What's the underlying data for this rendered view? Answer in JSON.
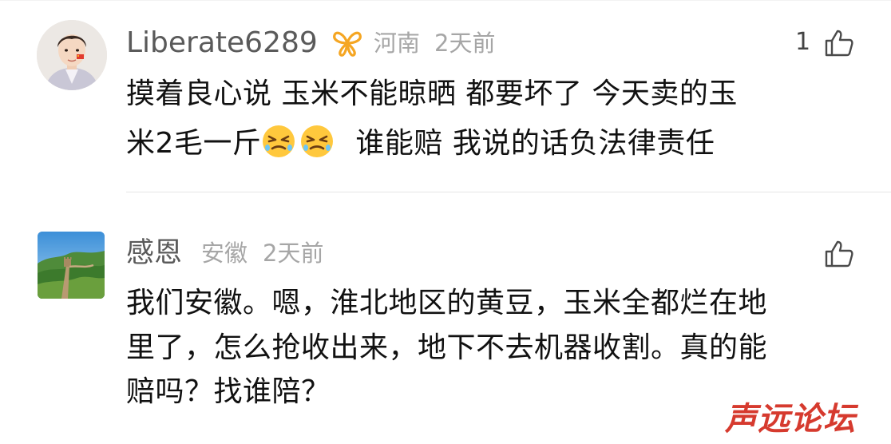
{
  "comments": [
    {
      "username": "Liberate6289",
      "vip_icon": "butterfly-vip-icon",
      "location": "河南",
      "time": "2天前",
      "likes": "1",
      "line1": "摸着良心说  玉米不能晾晒  都要坏了  今天卖的玉",
      "line2_pre": "米2毛一斤",
      "line2_emojis": [
        "angry-face-emoji",
        "angry-face-emoji"
      ],
      "line2_post": "谁能赔  我说的话负法律责任"
    },
    {
      "username": "感恩",
      "location": "安徽",
      "time": "2天前",
      "line1": "我们安徽。嗯，淮北地区的黄豆，玉米全都烂在地",
      "line2": "里了，怎么抢收出来，地下不去机器收割。真的能",
      "line3": "赔吗？找谁陪？"
    }
  ],
  "watermark": "声远论坛",
  "colors": {
    "username": "#5a5a5a",
    "meta": "#a6a6a6",
    "body_text": "#111111",
    "vip_orange": "#f5a623",
    "watermark": "#d63a2e"
  }
}
